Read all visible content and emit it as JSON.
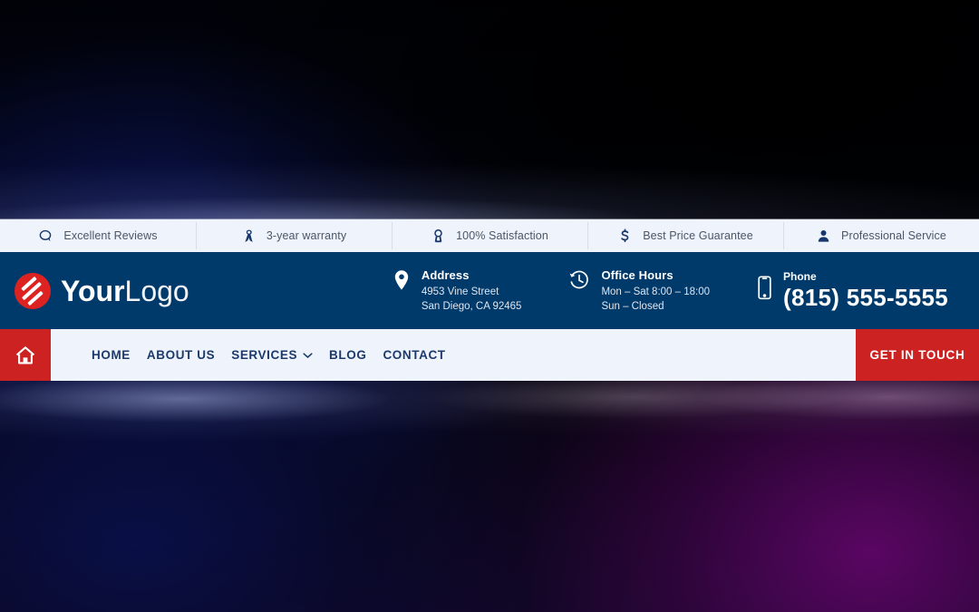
{
  "topbar": {
    "items": [
      {
        "icon": "comment-icon",
        "label": "Excellent Reviews"
      },
      {
        "icon": "ribbon-icon",
        "label": "3-year warranty"
      },
      {
        "icon": "award-medal-icon",
        "label": "100% Satisfaction"
      },
      {
        "icon": "dollar-sign-icon",
        "label": "Best Price Guarantee"
      },
      {
        "icon": "user-icon",
        "label": "Professional Service"
      }
    ]
  },
  "brand": {
    "logo_icon": "stripes-circle-logo-icon",
    "name_bold": "Your",
    "name_light": "Logo"
  },
  "contact": {
    "address": {
      "icon": "map-pin-icon",
      "title": "Address",
      "line1": "4953 Vine Street",
      "line2": "San Diego, CA 92465"
    },
    "hours": {
      "icon": "clock-history-icon",
      "title": "Office Hours",
      "line1": "Mon – Sat 8:00 – 18:00",
      "line2": "Sun – Closed"
    },
    "phone": {
      "icon": "mobile-phone-icon",
      "title": "Phone",
      "number": "(815) 555-5555"
    }
  },
  "nav": {
    "home_icon": "house-icon",
    "links": [
      {
        "label": "HOME",
        "has_caret": false
      },
      {
        "label": "ABOUT US",
        "has_caret": false
      },
      {
        "label": "SERVICES",
        "has_caret": true
      },
      {
        "label": "BLOG",
        "has_caret": false
      },
      {
        "label": "CONTACT",
        "has_caret": false
      }
    ],
    "cta_label": "GET IN TOUCH"
  },
  "colors": {
    "brand_blue": "#003a6b",
    "brand_red": "#cc2222",
    "logo_red": "#dd2222",
    "bar_light": "#eef3fc",
    "nav_text": "#1b3a6b",
    "topbar_text": "#4d5666",
    "topbar_icon": "#17366b"
  }
}
